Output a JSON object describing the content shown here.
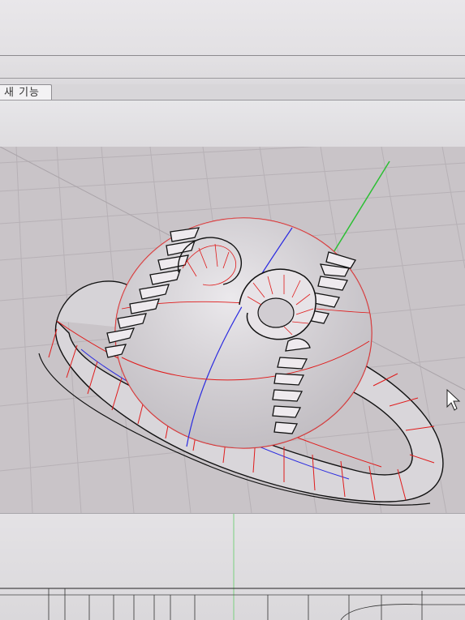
{
  "toolbar": {
    "tab_label": "새 기능"
  },
  "viewport": {
    "kind": "perspective",
    "model": "baseball-ring",
    "colors": {
      "grid": "#b9b3b8",
      "model_surface": "#d9d6da",
      "isocurve": "#e01a1a",
      "edge": "#111111",
      "axis_green": "#2cbf34",
      "axis_blue": "#2a2ae0"
    }
  },
  "cursor": {
    "icon": "mouse-pointer-icon"
  }
}
